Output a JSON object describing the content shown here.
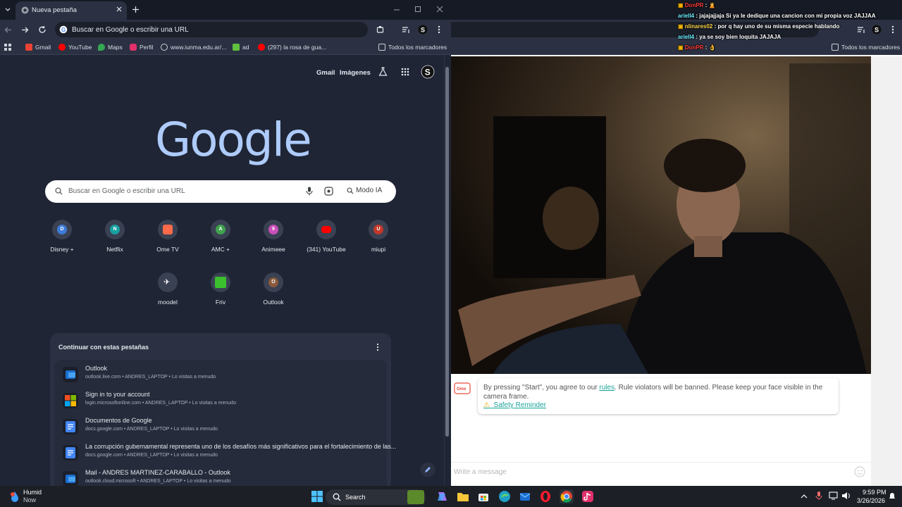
{
  "left_window": {
    "tab_title": "Nueva pestaña",
    "omnibox_text": "Buscar en Google o escribir una URL",
    "bookmarks": [
      {
        "label": "Gmail",
        "icon": "gmail-icon",
        "color": "#ea4335"
      },
      {
        "label": "YouTube",
        "icon": "youtube-icon",
        "color": "#ff0000"
      },
      {
        "label": "Maps",
        "icon": "maps-icon",
        "color": "#34a853"
      },
      {
        "label": "Perfil",
        "icon": "instagram-icon",
        "color": "#e1306c"
      },
      {
        "label": "www.iunma.edu.ar/...",
        "icon": "globe-icon",
        "color": "#9aa0a6"
      },
      {
        "label": "ad",
        "icon": "ad-icon",
        "color": "#5fbf3f"
      },
      {
        "label": "(297) la rosa de gua...",
        "icon": "youtube-icon",
        "color": "#ff0000"
      }
    ],
    "all_bookmarks": "Todos los marcadores"
  },
  "ntp": {
    "gmail": "Gmail",
    "images": "Imágenes",
    "logo": "Google",
    "search_placeholder": "Buscar en Google o escribir una URL",
    "ai_mode": "Modo IA",
    "shortcuts": [
      {
        "label": "Disney +",
        "letter": "D",
        "color": "#3d7bd9"
      },
      {
        "label": "Netflix",
        "letter": "N",
        "color": "#18a0a0"
      },
      {
        "label": "Ome TV",
        "letter": "",
        "color": "#ff6b4a"
      },
      {
        "label": "AMC +",
        "letter": "A",
        "color": "#3fa34d"
      },
      {
        "label": "Animeee",
        "letter": "9",
        "color": "#c94fb8"
      },
      {
        "label": "(341) YouTube",
        "letter": "",
        "color": "#ff0000"
      },
      {
        "label": "miupi",
        "letter": "U",
        "color": "#c0392b"
      },
      {
        "label": "moodel",
        "letter": "",
        "color": "#ffffff"
      },
      {
        "label": "Friv",
        "letter": "",
        "color": "#3cbf2f"
      },
      {
        "label": "Outlook",
        "letter": "O",
        "color": "#8a5a3c"
      }
    ],
    "continue_title": "Continuar con estas pestañas",
    "continue_items": [
      {
        "title": "Outlook",
        "sub": "outlook.live.com • ANDRES_LAPTOP • Lo visitas a menudo",
        "icon": "outlook-icon"
      },
      {
        "title": "Sign in to your account",
        "sub": "login.microsoftonline.com • ANDRES_LAPTOP • Lo visitas a menudo",
        "icon": "microsoft-icon"
      },
      {
        "title": "Documentos de Google",
        "sub": "docs.google.com • ANDRES_LAPTOP • Lo visitas a menudo",
        "icon": "docs-icon"
      },
      {
        "title": "La corrupción gubernamental representa uno de los desafíos más significativos para el fortalecimiento de las...",
        "sub": "docs.google.com • ANDRES_LAPTOP • Lo visitas a menudo",
        "icon": "docs-icon"
      },
      {
        "title": "Mail - ANDRES MARTINEZ-CARABALLO - Outlook",
        "sub": "outlook.cloud.microsoft • ANDRES_LAPTOP • Lo visitas a menudo",
        "icon": "outlook-icon"
      }
    ]
  },
  "right_window": {
    "all_bookmarks": "Todos los marcadores",
    "notice": {
      "before": "By pressing \"Start\", you agree to our ",
      "link": "rules",
      "after": ". Rule violators will be banned. Please keep your face visible in the camera frame.",
      "safety": "Safety Reminder"
    },
    "message_placeholder": "Write a message"
  },
  "chat": [
    {
      "user": "DonPR",
      "text": " : 🙎",
      "color": "#ff3b3b"
    },
    {
      "user": "ariell4",
      "text": " : jajajajjaja Si ya le dedique una cancion con mi propia voz JAJJAA",
      "color": "#6cf0ff"
    },
    {
      "user": "nlinares02",
      "text": " : por q hay uno de su misma especie hablando",
      "color": "#ffd84d"
    },
    {
      "user": "ariell4",
      "text": " : ya se soy bien loquita JAJAJA",
      "color": "#6cf0ff"
    },
    {
      "user": "DonPR",
      "text": " : 👌",
      "color": "#ff3b3b"
    }
  ],
  "taskbar": {
    "weather_title": "Humid",
    "weather_sub": "Now",
    "search_label": "Search",
    "time": "9:59 PM",
    "date": "3/26/2026"
  }
}
